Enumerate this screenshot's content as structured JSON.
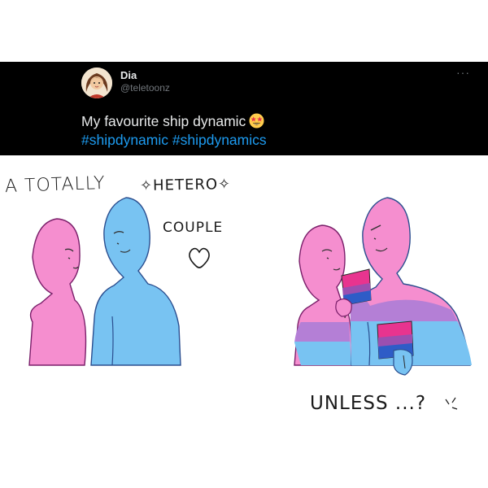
{
  "tweet": {
    "display_name": "Dia",
    "handle": "@teletoonz",
    "text": "My favourite ship dynamic",
    "emoji": "star-struck-emoji",
    "hashtags": [
      "#shipdynamic",
      "#shipdynamics"
    ],
    "more_icon": "more-horizontal-icon"
  },
  "comic": {
    "caption_left_1": "A TOTALLY",
    "caption_left_2": "✧HETERO✧",
    "caption_left_3": "COUPLE",
    "heart_icon": "heart-icon",
    "caption_right": "UNLESS ...?",
    "colors": {
      "pink": "#f58ecf",
      "blue": "#78c3f2",
      "purple": "#b47fd6",
      "outline": "#2b4e8f",
      "flag_pink": "#e8348f",
      "flag_purple": "#9b4fb0",
      "flag_blue": "#2e5cc7"
    }
  }
}
